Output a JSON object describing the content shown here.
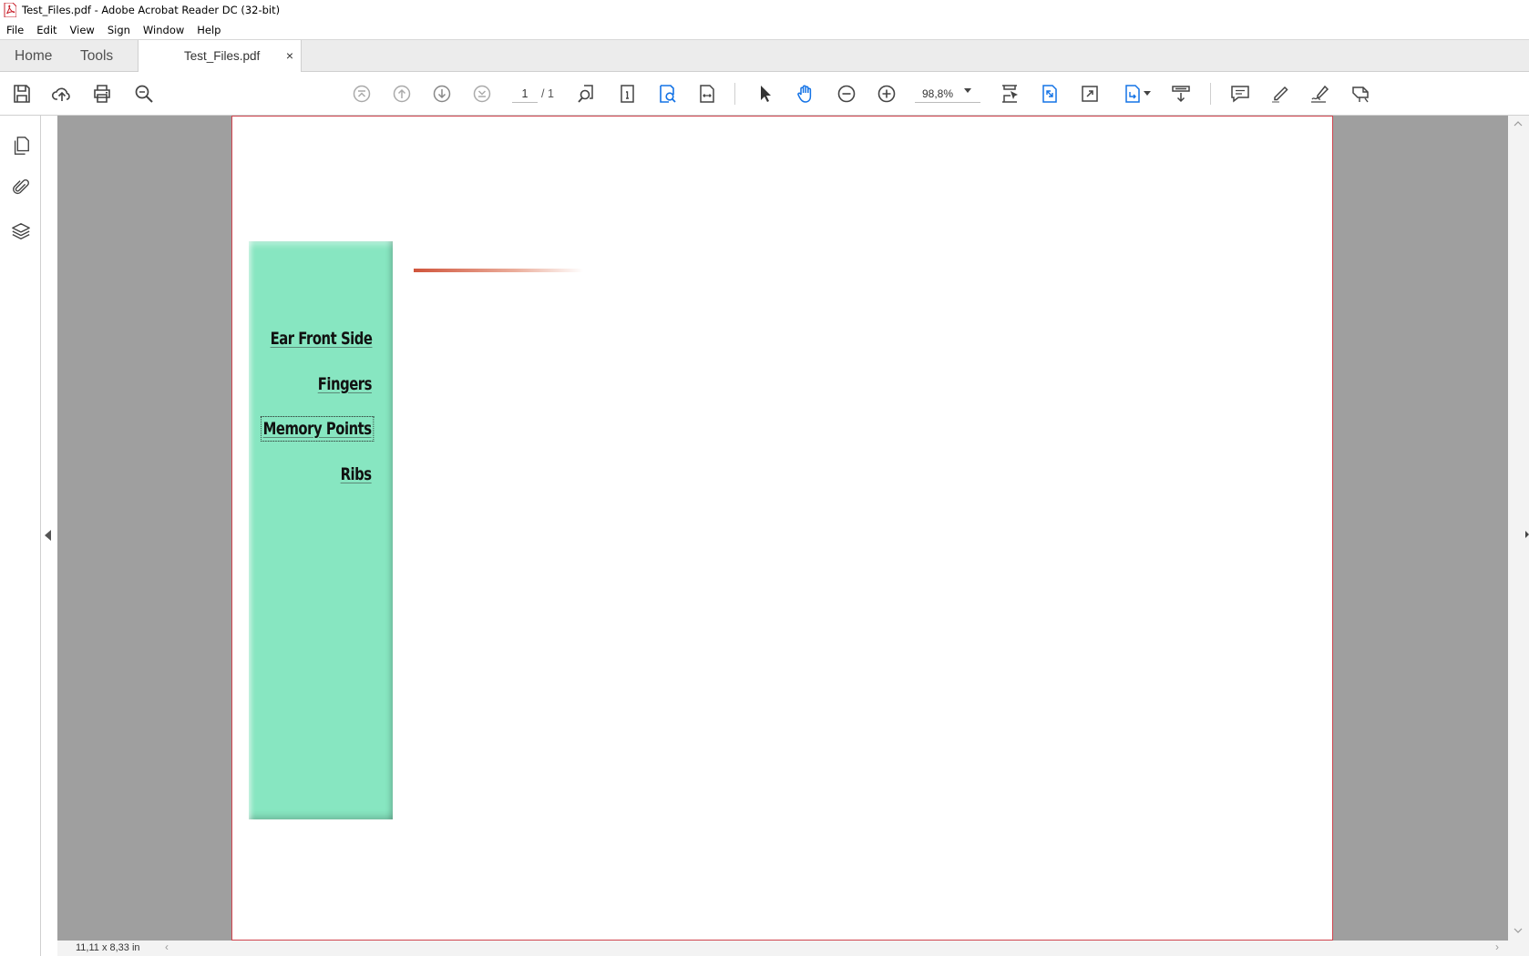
{
  "window": {
    "title": "Test_Files.pdf - Adobe Acrobat Reader DC (32-bit)"
  },
  "menu": [
    "File",
    "Edit",
    "View",
    "Sign",
    "Window",
    "Help"
  ],
  "tabs": {
    "home": "Home",
    "tools": "Tools",
    "document": "Test_Files.pdf",
    "close": "×"
  },
  "toolbar": {
    "page_current": "1",
    "page_total": "/ 1",
    "zoom": "98,8%"
  },
  "document": {
    "nav_links": [
      "Ear Front Side",
      "Fingers",
      "Memory Points",
      "Ribs"
    ],
    "focused_link": "Memory Points",
    "panel_color": "#87e6c1",
    "accent_color": "#d0553c",
    "page_border_color": "#d0444e"
  },
  "status": {
    "page_size": "11,11 x 8,33 in"
  },
  "icons": [
    "save-icon",
    "upload-icon",
    "print-icon",
    "search-zoom-icon",
    "first-page-icon",
    "prev-page-icon",
    "next-page-icon",
    "last-page-icon",
    "find-icon",
    "page-view-icon",
    "read-mode-icon",
    "fit-width-icon",
    "select-cursor-icon",
    "hand-icon",
    "zoom-out-icon",
    "zoom-in-icon",
    "marquee-zoom-icon",
    "fit-page-icon",
    "full-screen-icon",
    "rotate-icon",
    "tts-icon",
    "comment-icon",
    "highlight-icon",
    "sign-icon",
    "stamp-icon",
    "pages-icon",
    "attachment-icon",
    "layers-icon"
  ]
}
